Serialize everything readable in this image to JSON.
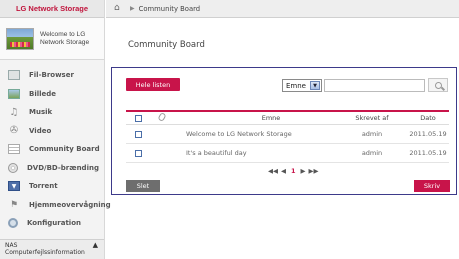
{
  "app": {
    "brand": "LG Network Storage",
    "welcome_line1": "Welcome to LG",
    "welcome_line2": "Network Storage"
  },
  "sidebar": {
    "items": [
      {
        "label": "Fil-Browser",
        "icon": "file-browser-icon"
      },
      {
        "label": "Billede",
        "icon": "photo-icon"
      },
      {
        "label": "Musik",
        "icon": "music-icon"
      },
      {
        "label": "Video",
        "icon": "video-icon"
      },
      {
        "label": "Community Board",
        "icon": "board-icon"
      },
      {
        "label": "DVD/BD-brænding",
        "icon": "disc-icon"
      },
      {
        "label": "Torrent",
        "icon": "torrent-icon"
      },
      {
        "label": "Hjemmeovervågning",
        "icon": "camera-icon"
      },
      {
        "label": "Konfiguration",
        "icon": "settings-icon"
      }
    ],
    "footer_line1": "NAS",
    "footer_line2": "Computerfejlssinformation"
  },
  "topbar": {
    "breadcrumb": "Community Board"
  },
  "page": {
    "title": "Community Board"
  },
  "toolbar": {
    "all_label": "Hele listen",
    "search_field_selected": "Emne",
    "search_value": ""
  },
  "table": {
    "headers": {
      "subject": "Emne",
      "author": "Skrevet af",
      "date": "Dato"
    },
    "rows": [
      {
        "subject": "Welcome to LG Network Storage",
        "author": "admin",
        "date": "2011.05.19"
      },
      {
        "subject": "It's a beautiful day",
        "author": "admin",
        "date": "2011.05.19"
      }
    ]
  },
  "pager": {
    "first": "◀◀",
    "prev": "◀",
    "current": "1",
    "next": "▶",
    "last": "▶▶"
  },
  "actions": {
    "delete_label": "Slet",
    "write_label": "Skriv"
  },
  "colors": {
    "accent": "#c8144a",
    "panel_border": "#3d3a8a"
  }
}
